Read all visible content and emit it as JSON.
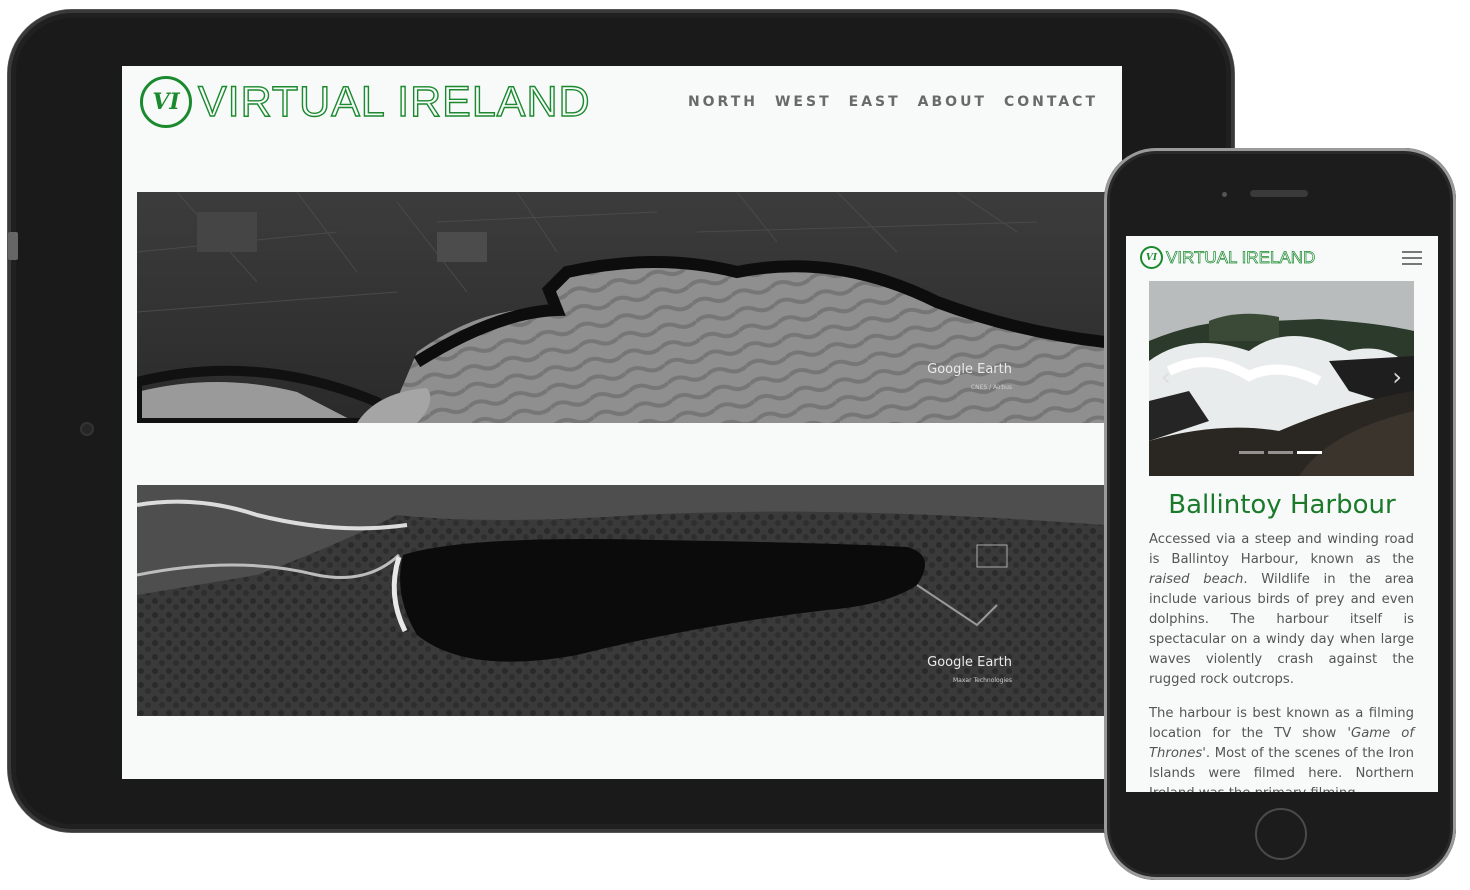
{
  "tablet": {
    "logo": {
      "emblem": "VI",
      "text": "VIRTUAL IRELAND"
    },
    "nav": [
      "NORTH",
      "WEST",
      "EAST",
      "ABOUT",
      "CONTACT"
    ],
    "images": [
      {
        "watermark": "Google Earth",
        "credit": "CNES / Airbus"
      },
      {
        "watermark": "Google Earth",
        "credit": "Maxar Technologies"
      }
    ]
  },
  "phone": {
    "logo": {
      "emblem": "VI",
      "text": "VIRTUAL IRELAND"
    },
    "menu_icon": "hamburger-icon",
    "carousel": {
      "prev": "‹",
      "next": "›",
      "indicators": 3,
      "active_index": 2
    },
    "title": "Ballintoy Harbour",
    "paragraph1": {
      "part1": "Accessed via a steep and winding road is Ballintoy Harbour, known as the ",
      "em1": "raised beach",
      "part2": ". Wildlife in the area include various birds of prey and even dolphins. The harbour itself is spectacular on a windy day when large waves violently crash against the rugged rock outcrops."
    },
    "paragraph2": {
      "part1": "The harbour is best known as a filming location for the TV show ",
      "em1": "'Game of Thrones'",
      "part2": ". Most of the scenes of the Iron Islands were filmed here. Northern Ireland was the primary filming"
    }
  },
  "colors": {
    "brand_green": "#1b8a2e",
    "nav_grey": "#6a6a6a",
    "screen_bg": "#f8fafa",
    "device_body": "#1a1a1a"
  }
}
